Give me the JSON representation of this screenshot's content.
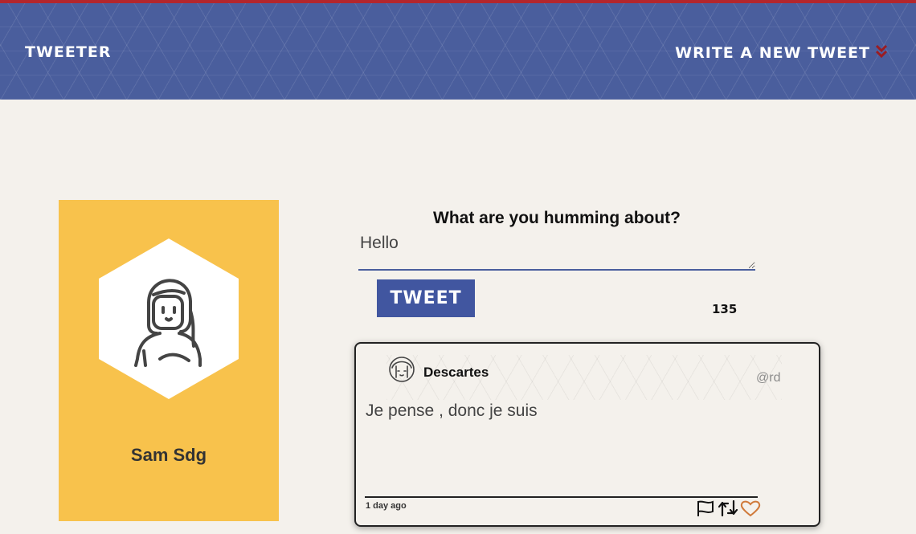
{
  "nav": {
    "brand": "TWEETER",
    "write_link": "WRITE A NEW TWEET",
    "write_icon": "double-chevron-down-icon"
  },
  "profile": {
    "name": "Sam Sdg",
    "avatar_icon": "person-avatar-icon",
    "card_color": "#f8c24c"
  },
  "compose": {
    "title": "What are you humming about?",
    "input_value": "Hello",
    "button_label": "TWEET",
    "char_counter": "135"
  },
  "tweets": [
    {
      "author": "Descartes",
      "handle": "@rd",
      "body": "Je pense , donc je suis",
      "time": "1 day ago",
      "actions": [
        "flag-icon",
        "retweet-icon",
        "heart-icon"
      ]
    }
  ],
  "colors": {
    "nav_bg": "#4a5e9d",
    "accent_red": "#b3262d",
    "button_bg": "#4156a0",
    "heart": "#d07a3a"
  }
}
